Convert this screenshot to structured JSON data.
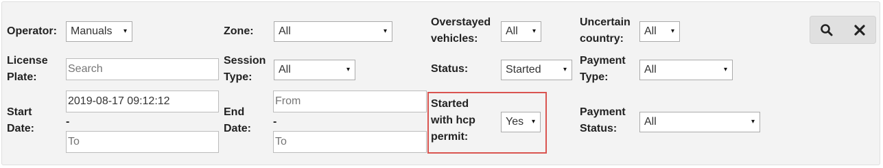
{
  "filters": {
    "operator": {
      "label": "Operator:",
      "value": "Manuals"
    },
    "zone": {
      "label": "Zone:",
      "value": "All"
    },
    "overstayed": {
      "label1": "Overstayed",
      "label2": "vehicles:",
      "value": "All"
    },
    "uncertain_country": {
      "label1": "Uncertain",
      "label2": "country:",
      "value": "All"
    },
    "license_plate": {
      "label1": "License",
      "label2": "Plate:",
      "placeholder": "Search"
    },
    "session_type": {
      "label1": "Session",
      "label2": "Type:",
      "value": "All"
    },
    "status": {
      "label": "Status:",
      "value": "Started"
    },
    "payment_type": {
      "label1": "Payment",
      "label2": "Type:",
      "value": "All"
    },
    "start_date": {
      "label1": "Start",
      "label2": "Date:",
      "from_value": "2019-08-17 09:12:12",
      "separator": "-",
      "to_placeholder": "To"
    },
    "end_date": {
      "label1": "End",
      "label2": "Date:",
      "from_placeholder": "From",
      "separator": "-",
      "to_placeholder": "To"
    },
    "hcp_permit": {
      "label1": "Started",
      "label2": "with hcp",
      "label3": "permit:",
      "value": "Yes"
    },
    "payment_status": {
      "label1": "Payment",
      "label2": "Status:",
      "value": "All"
    }
  },
  "actions": {
    "search_icon": "search-icon",
    "clear_icon": "close-icon"
  },
  "colors": {
    "panel_bg": "#f3f3f3",
    "highlight": "#d9534f",
    "button_bg": "#e0e0e0"
  },
  "icons": {
    "dropdown": "▾"
  }
}
